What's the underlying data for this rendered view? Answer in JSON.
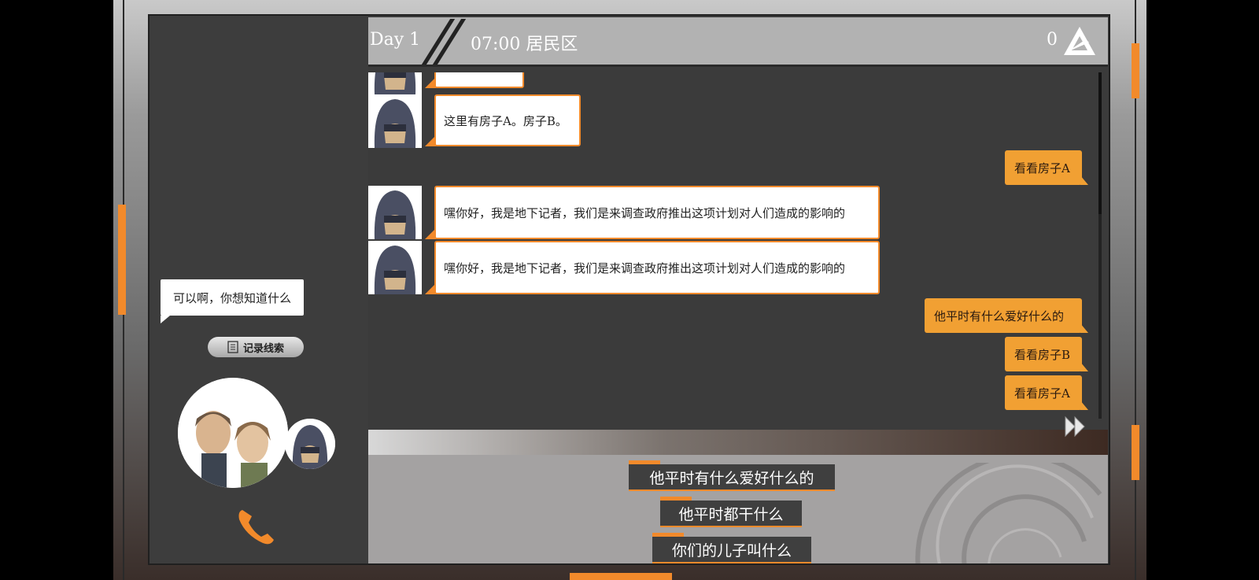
{
  "header": {
    "day": "Day 1",
    "time_location": "07:00 居民区",
    "score": "0",
    "logo_icon": "triangle-logo-icon"
  },
  "chat": {
    "messages": [
      {
        "from": "npc",
        "text": ""
      },
      {
        "from": "npc",
        "text": "这里有房子A。房子B。"
      },
      {
        "from": "player",
        "text": "看看房子A"
      },
      {
        "from": "npc",
        "text": "嘿你好，我是地下记者，我们是来调查政府推出这项计划对人们造成的影响的"
      },
      {
        "from": "npc",
        "text": "嘿你好，我是地下记者，我们是来调查政府推出这项计划对人们造成的影响的"
      },
      {
        "from": "player",
        "text": "他平时有什么爱好什么的"
      },
      {
        "from": "player",
        "text": "看看房子B"
      },
      {
        "from": "player",
        "text": "看看房子A"
      }
    ]
  },
  "left_panel": {
    "speech_bubble": "可以啊，你想知道什么",
    "record_button": "记录线索",
    "record_icon": "notebook-icon",
    "phone_icon": "phone-icon"
  },
  "options": [
    {
      "label": "他平时有什么爱好什么的"
    },
    {
      "label": "他平时都干什么"
    },
    {
      "label": "你们的儿子叫什么"
    }
  ],
  "controls": {
    "fast_forward_icon": "fast-forward-icon"
  },
  "colors": {
    "accent": "#f28a2b",
    "player_bubble": "#f1a033",
    "panel": "#3d3d3d",
    "header": "#b2b2b2"
  }
}
